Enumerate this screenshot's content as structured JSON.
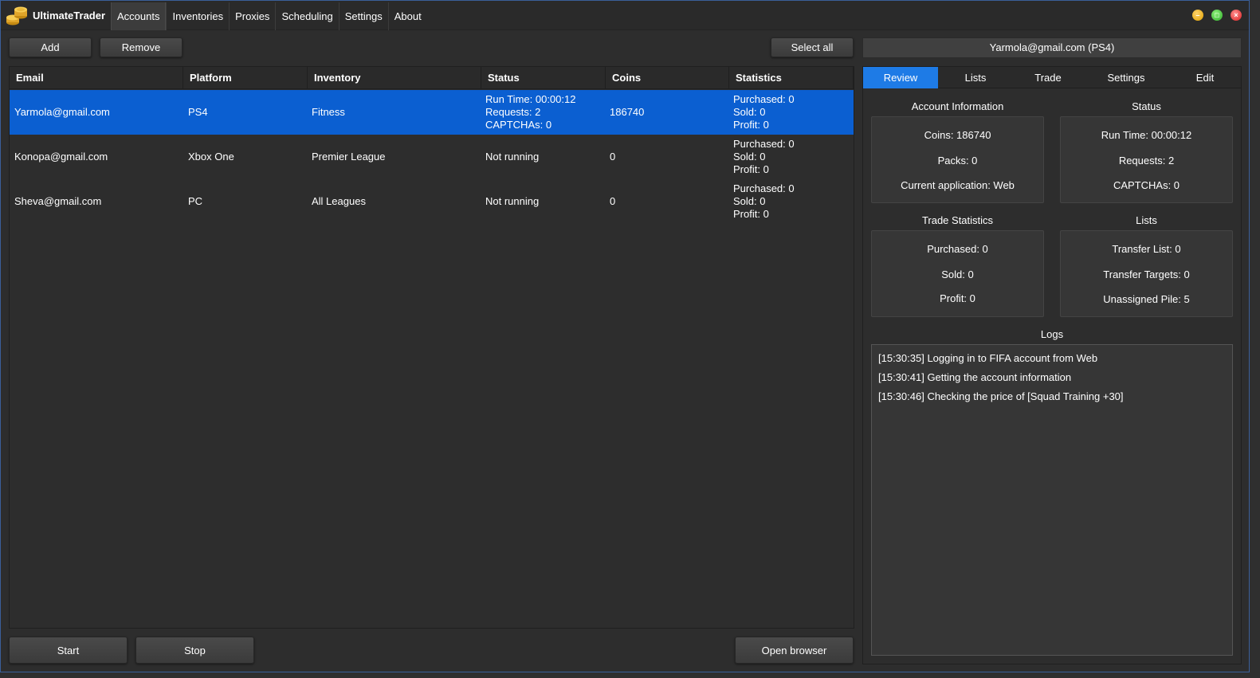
{
  "app": {
    "title": "UltimateTrader",
    "menu": [
      "Accounts",
      "Inventories",
      "Proxies",
      "Scheduling",
      "Settings",
      "About"
    ],
    "active_menu": "Accounts"
  },
  "toolbar": {
    "add_label": "Add",
    "remove_label": "Remove",
    "select_all_label": "Select all"
  },
  "table": {
    "columns": [
      "Email",
      "Platform",
      "Inventory",
      "Status",
      "Coins",
      "Statistics"
    ],
    "rows": [
      {
        "email": "Yarmola@gmail.com",
        "platform": "PS4",
        "inventory": "Fitness",
        "status": [
          "Run Time: 00:00:12",
          "Requests: 2",
          "CAPTCHAs: 0"
        ],
        "coins": "186740",
        "statistics": [
          "Purchased: 0",
          "Sold: 0",
          "Profit: 0"
        ],
        "selected": true
      },
      {
        "email": "Konopa@gmail.com",
        "platform": "Xbox One",
        "inventory": "Premier League",
        "status": [
          "Not running"
        ],
        "coins": "0",
        "statistics": [
          "Purchased: 0",
          "Sold: 0",
          "Profit: 0"
        ],
        "selected": false
      },
      {
        "email": "Sheva@gmail.com",
        "platform": "PC",
        "inventory": "All Leagues",
        "status": [
          "Not running"
        ],
        "coins": "0",
        "statistics": [
          "Purchased: 0",
          "Sold: 0",
          "Profit: 0"
        ],
        "selected": false
      }
    ]
  },
  "footer": {
    "start_label": "Start",
    "stop_label": "Stop",
    "open_browser_label": "Open browser"
  },
  "details": {
    "header": "Yarmola@gmail.com (PS4)",
    "tabs": [
      "Review",
      "Lists",
      "Trade",
      "Settings",
      "Edit"
    ],
    "active_tab": "Review",
    "account_information": {
      "title": "Account Information",
      "lines": [
        "Coins: 186740",
        "Packs: 0",
        "Current application: Web"
      ]
    },
    "status": {
      "title": "Status",
      "lines": [
        "Run Time: 00:00:12",
        "Requests: 2",
        "CAPTCHAs: 0"
      ]
    },
    "trade_statistics": {
      "title": "Trade Statistics",
      "lines": [
        "Purchased: 0",
        "Sold: 0",
        "Profit: 0"
      ]
    },
    "lists": {
      "title": "Lists",
      "lines": [
        "Transfer List: 0",
        "Transfer Targets: 0",
        "Unassigned Pile: 5"
      ]
    },
    "logs": {
      "title": "Logs",
      "lines": [
        "[15:30:35] Logging in to FIFA account from Web",
        "[15:30:41] Getting the account information",
        "[15:30:46] Checking the price of [Squad Training +30]"
      ]
    }
  },
  "colors": {
    "accent": "#1e7be6",
    "selected_row": "#0b5fd1",
    "background": "#2d2d2d"
  }
}
